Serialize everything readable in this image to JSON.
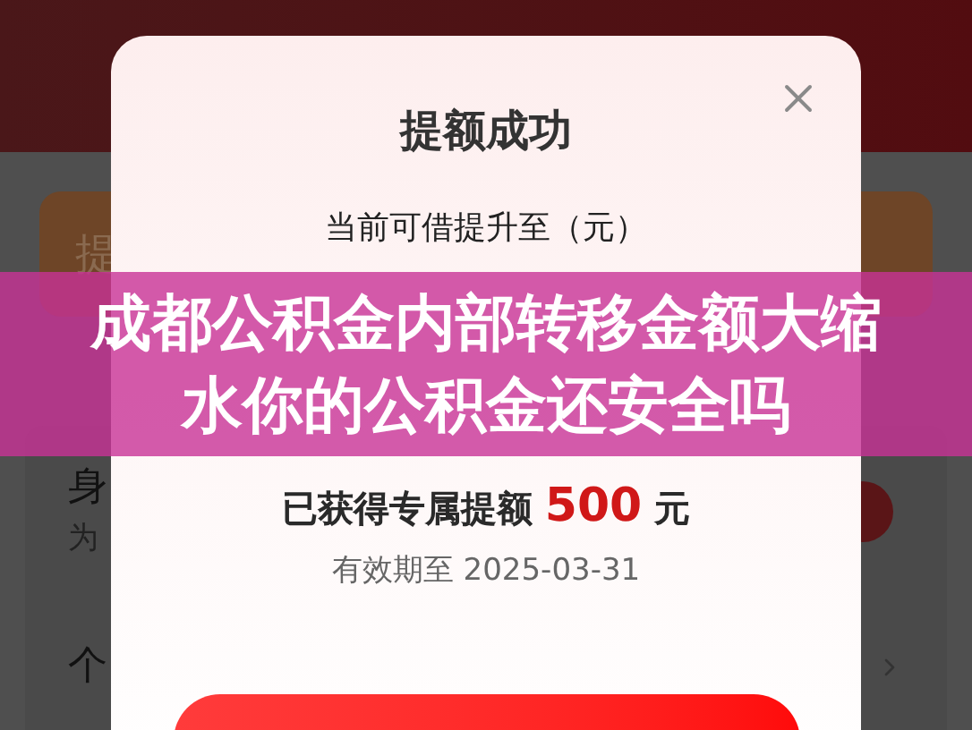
{
  "background": {
    "promo_card": {
      "label": "提"
    },
    "rows": [
      {
        "title": "身",
        "subtitle": "为"
      },
      {
        "title": "个"
      }
    ]
  },
  "dialog": {
    "title": "提额成功",
    "subtitle": "当前可借提升至（元）",
    "bonus": {
      "prefix": "已获得专属提额",
      "amount": "500",
      "unit": "元"
    },
    "validity": "有效期至 2025-03-31"
  },
  "overlay_title": "成都公积金内部转移金额大缩水你的公积金还安全吗"
}
